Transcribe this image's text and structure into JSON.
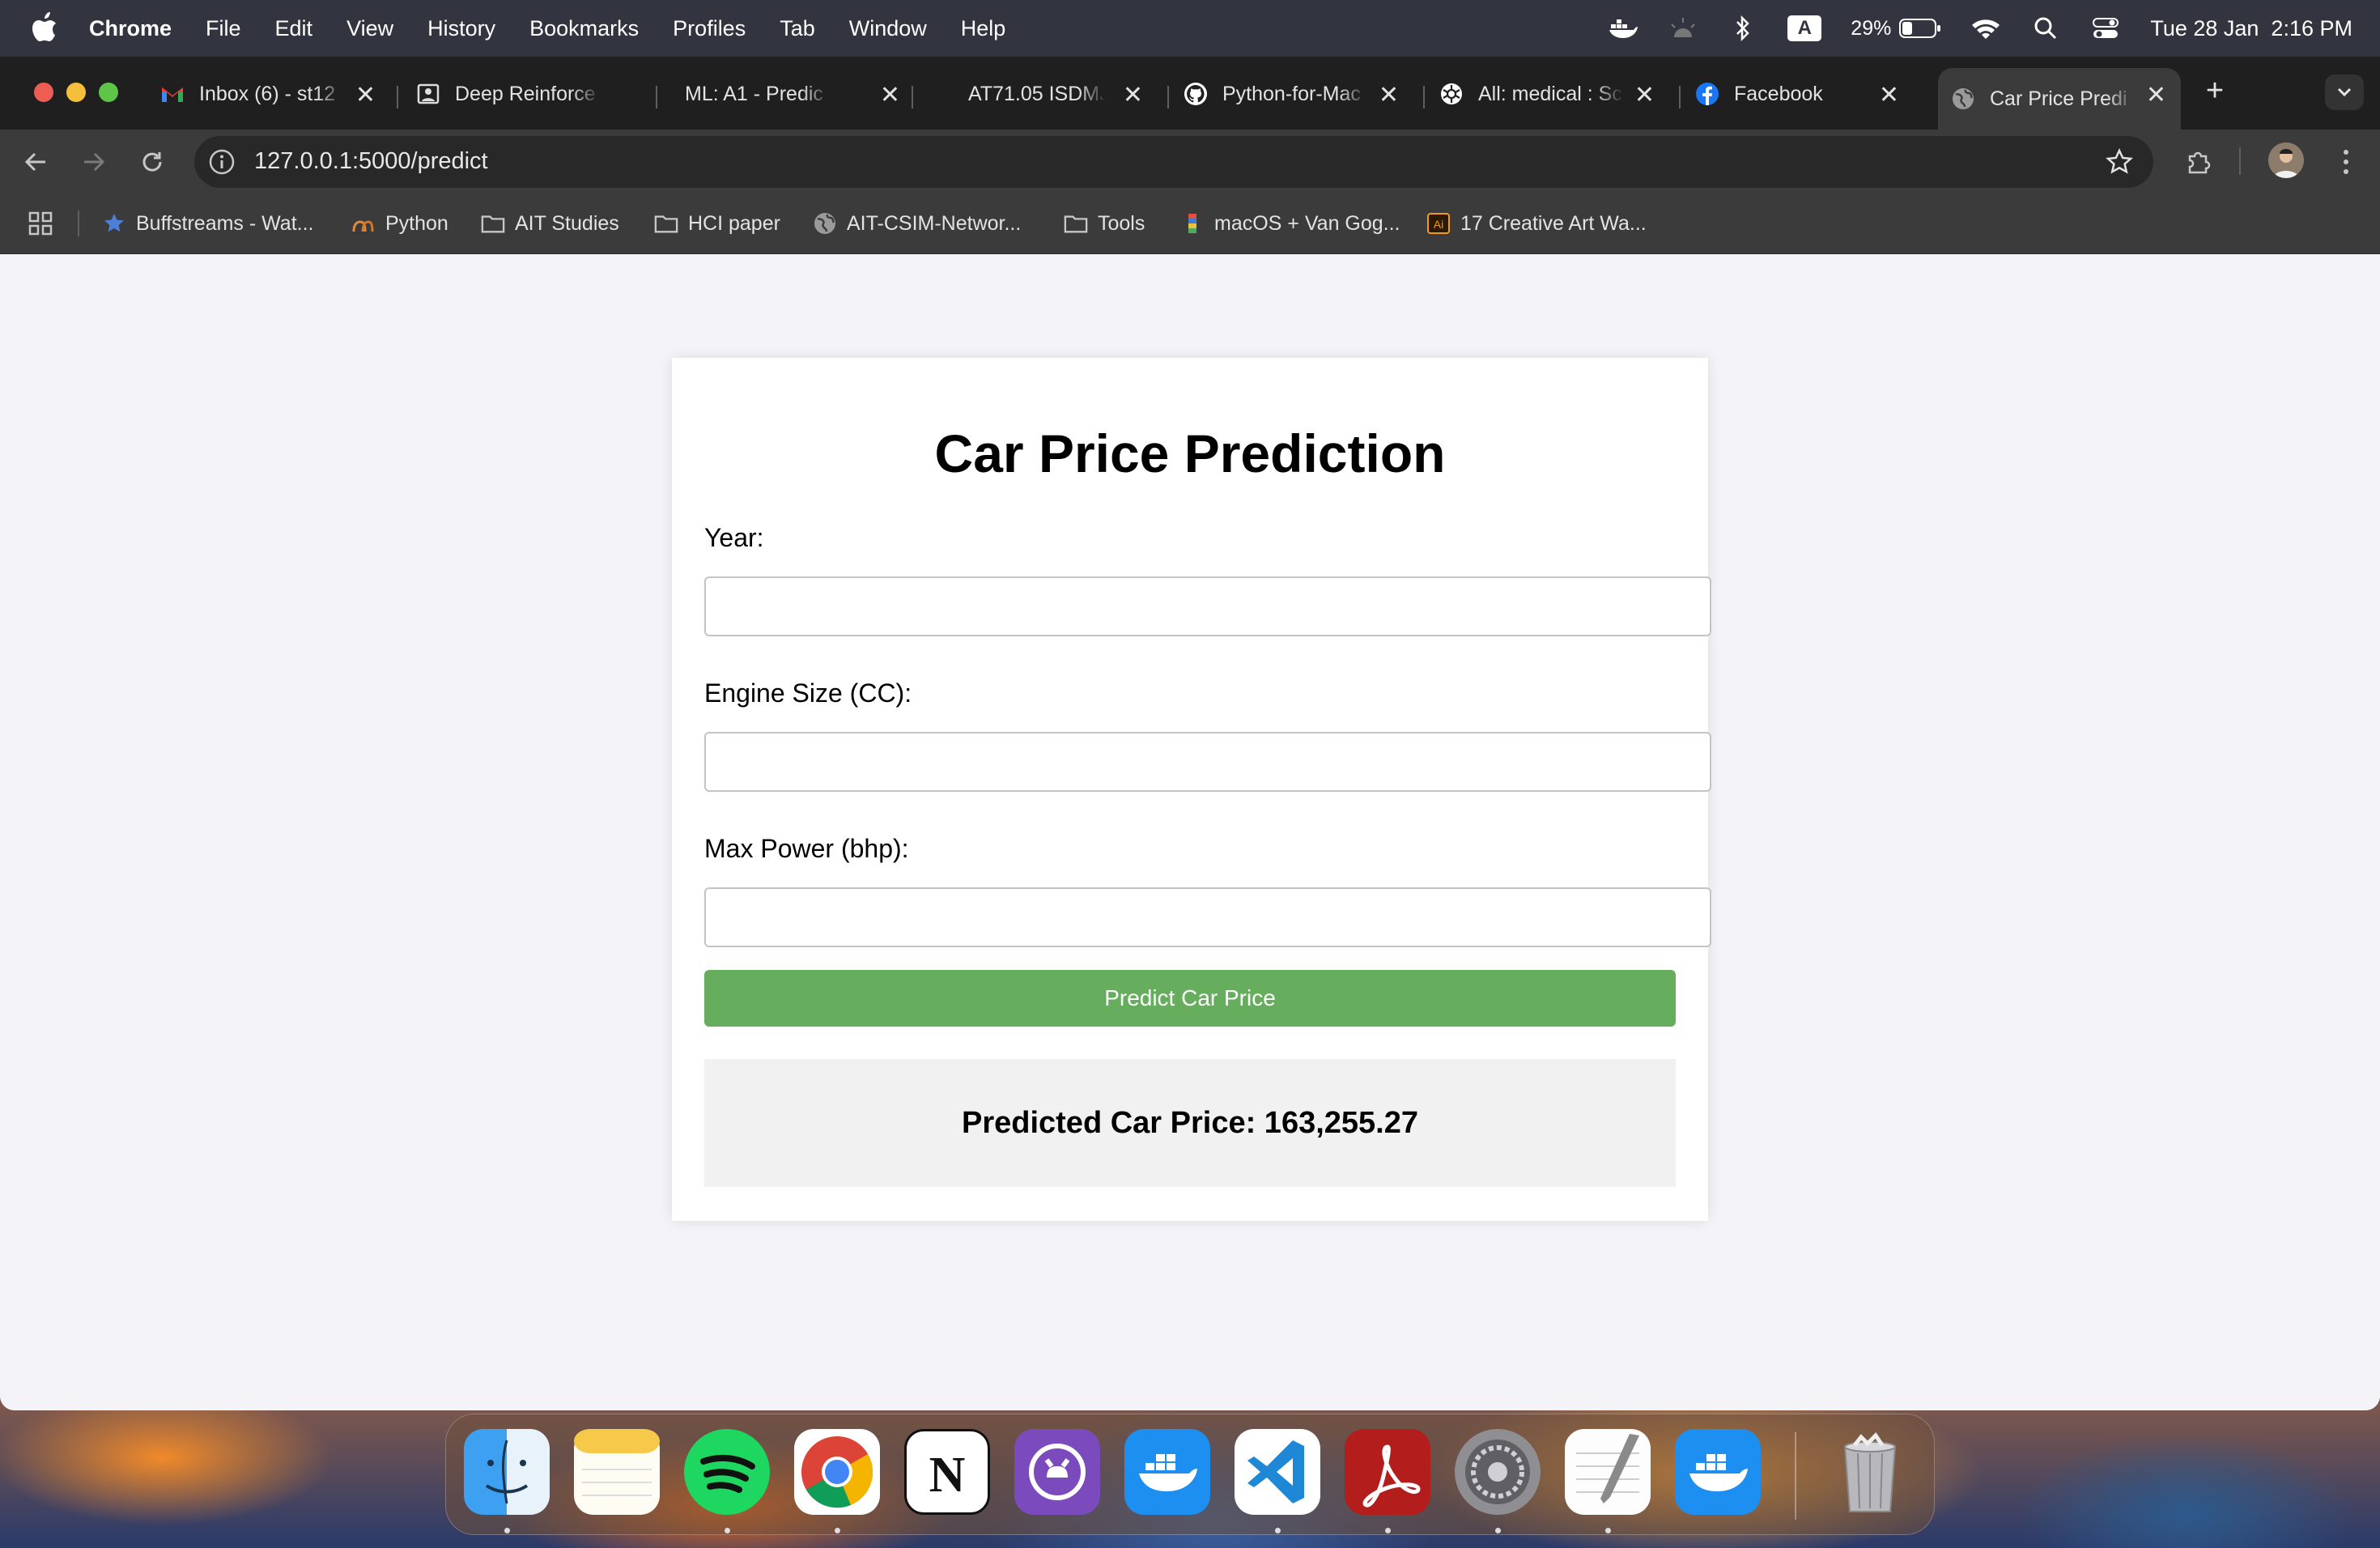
{
  "menubar": {
    "app_name": "Chrome",
    "menus": [
      "File",
      "Edit",
      "View",
      "History",
      "Bookmarks",
      "Profiles",
      "Tab",
      "Window",
      "Help"
    ],
    "battery": "29%",
    "keyboard_input": "A",
    "datetime": "Tue 28 Jan  2:16 PM"
  },
  "tabs": [
    {
      "title": "Inbox (6) - st12",
      "icon": "gmail-icon"
    },
    {
      "title": "Deep Reinforce",
      "icon": "doc-icon"
    },
    {
      "title": "ML: A1 - Predic",
      "icon": "none"
    },
    {
      "title": "AT71.05 ISDMJ",
      "icon": "none"
    },
    {
      "title": "Python-for-Mac",
      "icon": "github-icon"
    },
    {
      "title": "All: medical : Sc",
      "icon": "openai-icon"
    },
    {
      "title": "Facebook",
      "icon": "facebook-icon"
    },
    {
      "title": "Car Price Predi",
      "icon": "globe-icon",
      "active": true
    }
  ],
  "address_bar": {
    "url": "127.0.0.1:5000/predict"
  },
  "bookmarks": [
    {
      "label": "Buffstreams - Wat...",
      "icon": "star-icon"
    },
    {
      "label": "Python",
      "icon": "python-icon"
    },
    {
      "label": "AIT Studies",
      "icon": "folder-icon"
    },
    {
      "label": "HCI paper",
      "icon": "folder-icon"
    },
    {
      "label": "AIT-CSIM-Networ...",
      "icon": "globe-icon"
    },
    {
      "label": "Tools",
      "icon": "folder-icon"
    },
    {
      "label": "macOS + Van Gog...",
      "icon": "bookmark-icon"
    },
    {
      "label": "17 Creative Art Wa...",
      "icon": "illustrator-icon"
    }
  ],
  "page": {
    "title": "Car Price Prediction",
    "fields": [
      {
        "label": "Year:",
        "value": "",
        "placeholder": ""
      },
      {
        "label": "Engine Size (CC):",
        "value": "",
        "placeholder": ""
      },
      {
        "label": "Max Power (bhp):",
        "value": "",
        "placeholder": ""
      }
    ],
    "submit_label": "Predict Car Price",
    "result_text": "Predicted Car Price: 163,255.27"
  },
  "dock": {
    "apps": [
      "Finder",
      "Notes",
      "Spotify",
      "Chrome",
      "Notion",
      "GitHub Desktop",
      "Docker",
      "VS Code",
      "Acrobat",
      "System Settings",
      "TextEdit",
      "Docker Desktop",
      "Trash"
    ]
  },
  "colors": {
    "accent_green": "#66ad5d",
    "tab_strip": "#1f1f1f",
    "toolbar": "#3b3b3b",
    "page_bg": "#f4f4f8"
  }
}
